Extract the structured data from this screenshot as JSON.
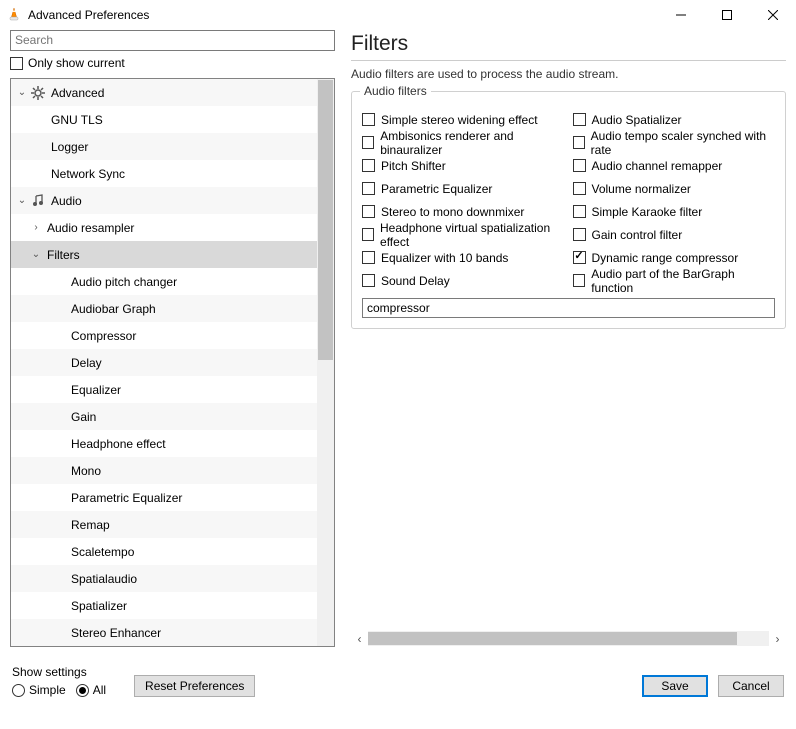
{
  "window": {
    "title": "Advanced Preferences"
  },
  "search": {
    "placeholder": "Search"
  },
  "only_show_current": "Only show current",
  "tree": {
    "advanced": "Advanced",
    "gnu_tls": "GNU TLS",
    "logger": "Logger",
    "network_sync": "Network Sync",
    "audio": "Audio",
    "audio_resampler": "Audio resampler",
    "filters": "Filters",
    "items": [
      "Audio pitch changer",
      "Audiobar Graph",
      "Compressor",
      "Delay",
      "Equalizer",
      "Gain",
      "Headphone effect",
      "Mono",
      "Parametric Equalizer",
      "Remap",
      "Scaletempo",
      "Spatialaudio",
      "Spatializer",
      "Stereo Enhancer"
    ]
  },
  "panel": {
    "title": "Filters",
    "description": "Audio filters are used to process the audio stream.",
    "group_legend": "Audio filters",
    "left_opts": [
      {
        "label": "Simple stereo widening effect",
        "checked": false
      },
      {
        "label": "Ambisonics renderer and binauralizer",
        "checked": false
      },
      {
        "label": "Pitch Shifter",
        "checked": false
      },
      {
        "label": "Parametric Equalizer",
        "checked": false
      },
      {
        "label": "Stereo to mono downmixer",
        "checked": false
      },
      {
        "label": "Headphone virtual spatialization effect",
        "checked": false
      },
      {
        "label": "Equalizer with 10 bands",
        "checked": false
      },
      {
        "label": "Sound Delay",
        "checked": false
      }
    ],
    "right_opts": [
      {
        "label": "Audio Spatializer",
        "checked": false
      },
      {
        "label": "Audio tempo scaler synched with rate",
        "checked": false
      },
      {
        "label": "Audio channel remapper",
        "checked": false
      },
      {
        "label": "Volume normalizer",
        "checked": false
      },
      {
        "label": "Simple Karaoke filter",
        "checked": false
      },
      {
        "label": "Gain control filter",
        "checked": false
      },
      {
        "label": "Dynamic range compressor",
        "checked": true
      },
      {
        "label": "Audio part of the BarGraph function",
        "checked": false
      }
    ],
    "filter_value": "compressor"
  },
  "bottom": {
    "show_settings": "Show settings",
    "simple": "Simple",
    "all": "All",
    "reset": "Reset Preferences",
    "save": "Save",
    "cancel": "Cancel"
  }
}
